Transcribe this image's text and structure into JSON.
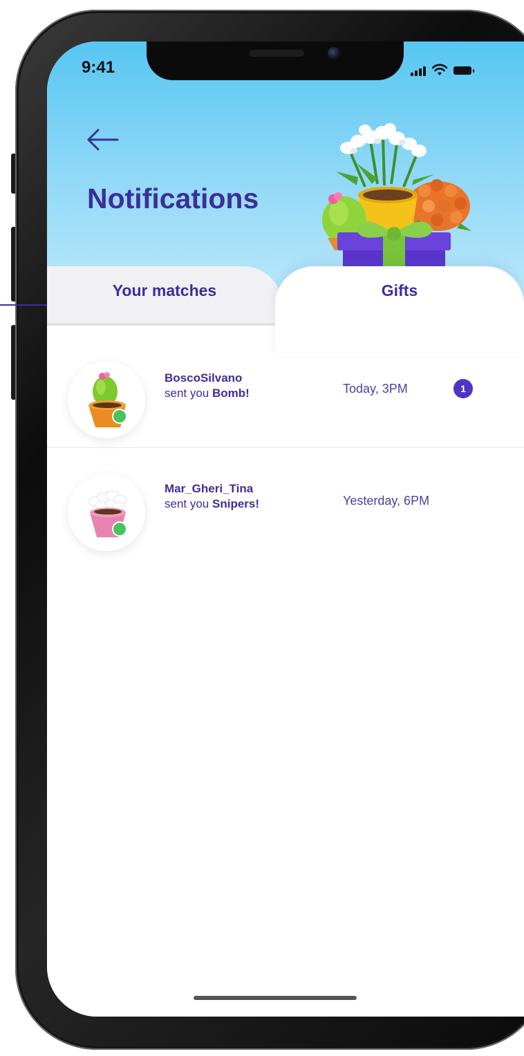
{
  "status_bar": {
    "time": "9:41"
  },
  "header": {
    "back_icon": "arrow-left-icon",
    "title": "Notifications",
    "illustration": "gift-box-with-plants"
  },
  "tabs": [
    {
      "label": "Your matches",
      "selected": false
    },
    {
      "label": "Gifts",
      "selected": true
    }
  ],
  "notifications": [
    {
      "sender": "BoscoSilvano",
      "action": "sent you",
      "gift": "Bomb!",
      "time": "Today, 3PM",
      "unread_count": "1",
      "online": true,
      "plant": "cactus-in-orange-pot"
    },
    {
      "sender": "Mar_Gheri_Tina",
      "action": "sent you",
      "gift": "Snipers!",
      "time": "Yesterday, 6PM",
      "online": true,
      "plant": "white-flowers-in-pink-pot"
    }
  ],
  "colors": {
    "primary": "#3c2e9b",
    "badge": "#4f34c9",
    "online": "#47c45c",
    "header_top": "#57c6f2",
    "header_bottom": "#c7ebfb"
  }
}
